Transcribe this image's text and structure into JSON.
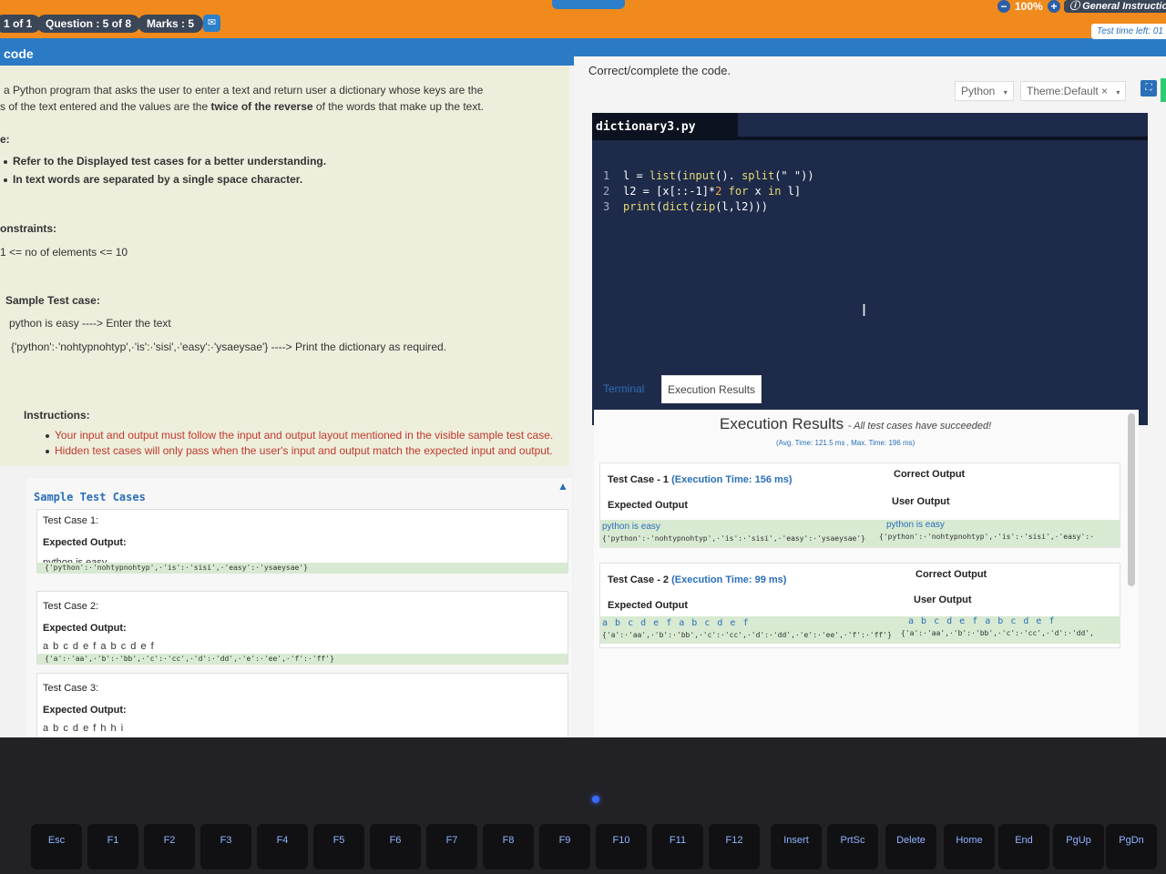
{
  "header": {
    "section_pill": "1 of 1",
    "question_pill": "Question : 5 of 8",
    "marks_pill": "Marks : 5",
    "chat_icon": "chat-bubble-icon",
    "zoom_level": "100%",
    "zoom_minus": "−",
    "zoom_plus": "+",
    "general_instructions": "General Instructions",
    "accent_color": "#f08a1c"
  },
  "subheader": {
    "title": "code",
    "time_left": "Test time left: 01",
    "color": "#2a7ac6"
  },
  "question": {
    "line1": "a Python program that asks the user to enter a text and return user a dictionary whose keys are the",
    "line2_pre": "s of the text entered and the values are the ",
    "line2_bold": "twice of the reverse",
    "line2_post": " of the words that make up the text.",
    "note_label": "e:",
    "note1": "Refer to the Displayed test cases for a better understanding.",
    "note2": "In text words are separated by a single space character.",
    "constraints_label": "onstraints:",
    "constraint1": "1 <= no of elements <= 10",
    "sample_label": "Sample Test case:",
    "sample_input": "python is easy ----> Enter the text",
    "sample_output": "{'python':·'nohtypnohtyp',·'is':·'sisi',·'easy':·'ysaeysae'} ----> Print the dictionary as required.",
    "instructions_label": "Instructions:",
    "instruction1": "Your input and output must follow the input and output layout mentioned in the visible sample test case.",
    "instruction2": "Hidden test cases will only pass when the user's input and output match the expected input and output."
  },
  "samples": {
    "heading": "Sample Test Cases",
    "cases": [
      {
        "label": "Test Case 1:",
        "expected": "Expected Output:",
        "input": "python is easy",
        "output": "{'python':·'nohtypnohtyp',·'is':·'sisi',·'easy':·'ysaeysae'}"
      },
      {
        "label": "Test Case 2:",
        "expected": "Expected Output:",
        "input": "a b c d e f a b c d e f",
        "output": "{'a':·'aa',·'b':·'bb',·'c':·'cc',·'d':·'dd',·'e':·'ee',·'f':·'ff'}"
      },
      {
        "label": "Test Case 3:",
        "expected": "Expected Output:",
        "input": "a b c d e f h h i",
        "output": ""
      }
    ]
  },
  "editor": {
    "instruction": "Correct/complete the code.",
    "language": "Python",
    "theme": "Theme:Default",
    "filename": "dictionary3.py",
    "lines": [
      {
        "n": "1",
        "a": "l = ",
        "b": "list",
        "c": "(",
        "d": "input",
        "e": "(). ",
        "f": "split",
        "g": "(\" \"))"
      },
      {
        "n": "2",
        "a": "l2 = [x[::-1]*",
        "num": "2",
        "kw": " for ",
        "rest": "x",
        "kw2": " in ",
        "end": "l]"
      },
      {
        "n": "3",
        "a": "print",
        "b": "(",
        "c": "dict",
        "d": "(",
        "e": "zip",
        "f": "(l,l2)))"
      }
    ]
  },
  "tabs": {
    "terminal": "Terminal",
    "execution": "Execution Results"
  },
  "results": {
    "title": "Execution Results",
    "success": "- All test cases have succeeded!",
    "avg": "(Avg. Time: 121.5 ms , Max. Time: 196 ms)",
    "cases": [
      {
        "label": "Test Case - 1",
        "time": "(Execution Time: 156 ms)",
        "correct": "Correct Output",
        "expected": "Expected Output",
        "user": "User Output",
        "exp_input": "python is easy",
        "exp_output": "{'python':·'nohtypnohtyp',·'is':·'sisi',·'easy':·'ysaeysae'}",
        "user_input": "python is easy",
        "user_output": "{'python':·'nohtypnohtyp',·'is':·'sisi',·'easy':·"
      },
      {
        "label": "Test Case - 2",
        "time": "(Execution Time: 99 ms)",
        "correct": "Correct Output",
        "expected": "Expected Output",
        "user": "User Output",
        "exp_input": "a b c d e f a b c d e f",
        "exp_output": "{'a':·'aa',·'b':·'bb',·'c':·'cc',·'d':·'dd',·'e':·'ee',·'f':·'ff'}",
        "user_input": "a b c d e f a b c d e f",
        "user_output": "{'a':·'aa',·'b':·'bb',·'c':·'cc',·'d':·'dd',"
      }
    ]
  },
  "keyboard": {
    "keys": [
      "Esc",
      "F1",
      "F2",
      "F3",
      "F4",
      "F5",
      "F6",
      "F7",
      "F8",
      "F9",
      "F10",
      "F11",
      "F12",
      "Insert",
      "PrtSc",
      "Delete",
      "Home",
      "End",
      "PgUp",
      "PgDn"
    ]
  }
}
